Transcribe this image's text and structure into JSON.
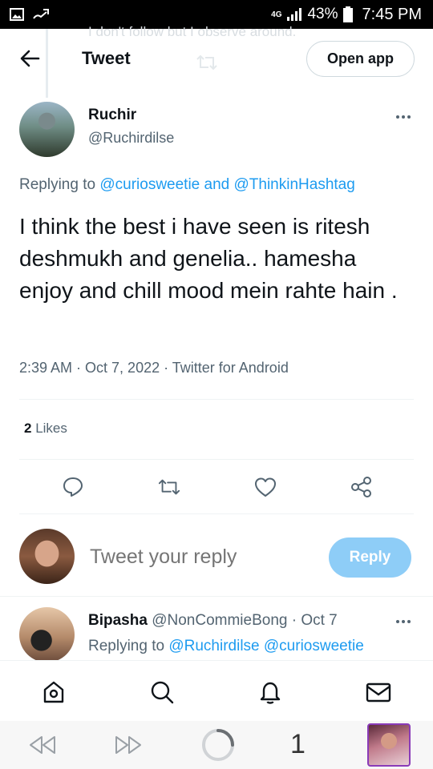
{
  "status_bar": {
    "network": "4G",
    "battery": "43%",
    "time": "7:45 PM"
  },
  "header": {
    "title": "Tweet",
    "open_app_label": "Open app",
    "ghost_text": "I don't follow but I observe around."
  },
  "tweet": {
    "author_name": "Ruchir",
    "author_handle": "@Ruchirdilse",
    "replying_prefix": "Replying to",
    "replying_to": "@curiosweetie and @ThinkinHashtag",
    "text": "I think the best i have seen is ritesh deshmukh and genelia.. hamesha enjoy and chill mood mein rahte hain .",
    "meta": "2:39 AM · Oct 7, 2022 · Twitter for Android",
    "likes_count": "2",
    "likes_label": "Likes"
  },
  "composer": {
    "placeholder": "Tweet your reply",
    "reply_label": "Reply"
  },
  "reply2": {
    "name": "Bipasha",
    "handle_date": "@NonCommieBong · Oct 7",
    "replying_prefix": "Replying to",
    "replying_to": "@Ruchirdilse @curiosweetie"
  },
  "browser_bar": {
    "tab_count": "1"
  },
  "icons": {
    "back": "arrow-left-icon",
    "more": "more-horizontal-icon",
    "reply": "comment-icon",
    "retweet": "retweet-icon",
    "like": "heart-icon",
    "share": "share-icon",
    "home": "home-icon",
    "explore": "search-icon",
    "notifications": "bell-icon",
    "messages": "mail-icon"
  },
  "colors": {
    "accent": "#1d9bf0",
    "reply_button_disabled": "#8ecdf7",
    "muted_text": "#536471"
  }
}
